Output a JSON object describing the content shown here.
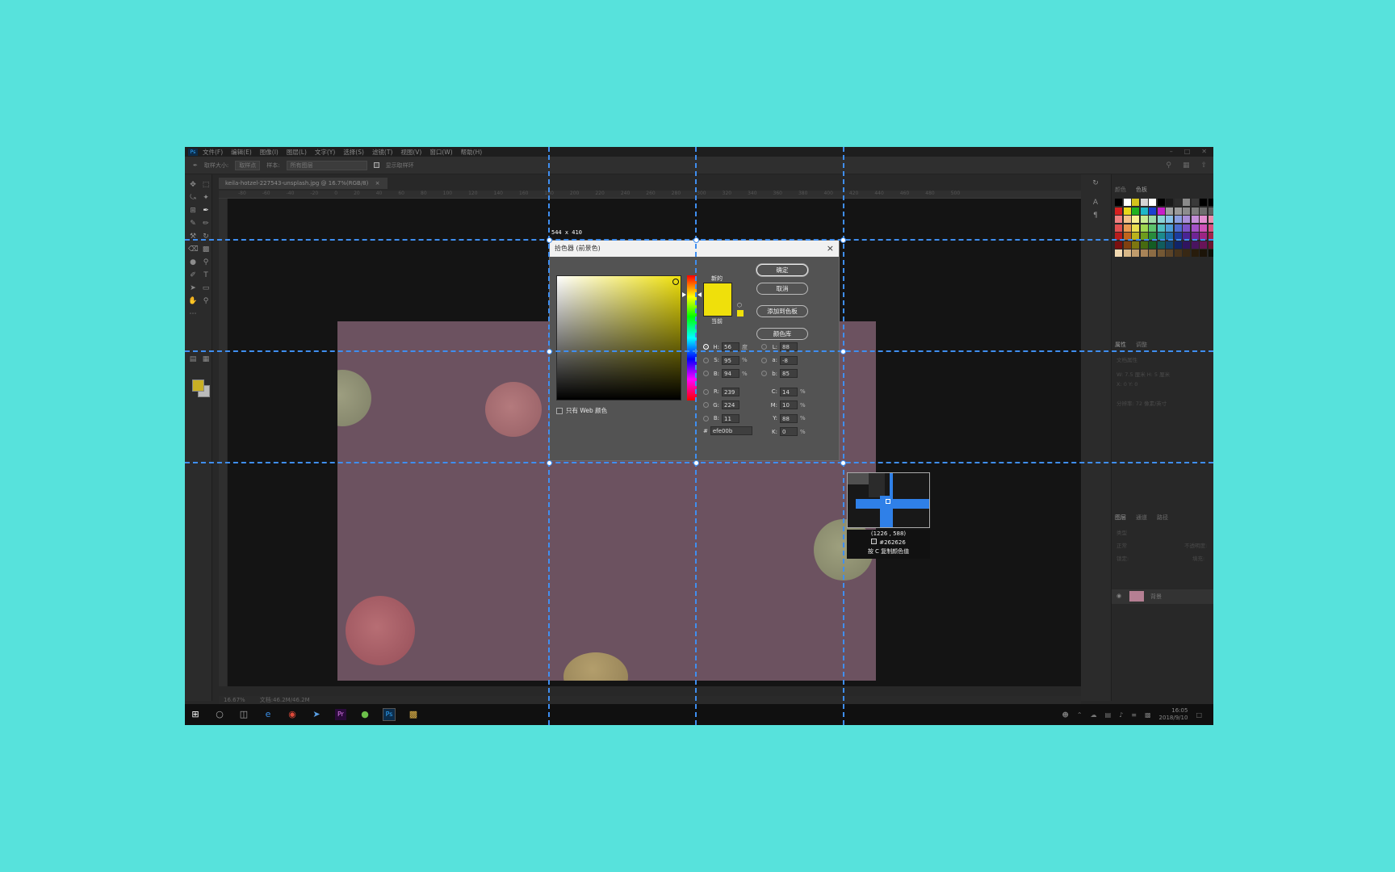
{
  "app": {
    "logo": "Ps",
    "menu": [
      "文件(F)",
      "编辑(E)",
      "图像(I)",
      "图层(L)",
      "文字(Y)",
      "选择(S)",
      "滤镜(T)",
      "视图(V)",
      "窗口(W)",
      "帮助(H)"
    ]
  },
  "options": {
    "sample_size_label": "取样大小:",
    "sample_size_value": "取样点",
    "sample_label": "样本:",
    "sample_value": "所有图层",
    "show_ring_label": "显示取样环"
  },
  "document": {
    "tab": "keila-hotzel-227543-unsplash.jpg @ 16.7%(RGB/8)",
    "tab_close": "×",
    "zoom": "16.67%",
    "doc_size": "文档:46.2M/46.2M"
  },
  "ruler_ticks": [
    "-80",
    "-60",
    "-40",
    "-20",
    "0",
    "20",
    "40",
    "60",
    "80",
    "100",
    "120",
    "140",
    "160",
    "180",
    "200",
    "220",
    "240",
    "260",
    "280",
    "300",
    "320",
    "340",
    "360",
    "380",
    "400",
    "420",
    "440",
    "460",
    "480",
    "500"
  ],
  "panels": {
    "swatches_tabs": [
      "颜色",
      "色板"
    ],
    "properties_tabs": [
      "属性",
      "调整"
    ],
    "properties_lines": [
      "文档属性",
      "W: 7.5 厘米      H: 5 厘米",
      "X: 0           Y: 0",
      "分辨率: 72 像素/英寸"
    ],
    "layers_tabs": [
      "图层",
      "通道",
      "路径"
    ],
    "layers_filter": "类型",
    "layers_blend": "正常",
    "layers_opacity": "不透明度:",
    "layers_lock": "锁定:",
    "layers_fill": "填充:",
    "layer_name": "背景"
  },
  "colors": {
    "accent": "#efe00b",
    "guide": "#3f8ef0",
    "swatch_rows": [
      [
        "#000000",
        "#ffffff",
        "#d2c21d",
        "#d4d4d4",
        "#ffffff",
        "#000000",
        "#1a1a1a",
        "#2d2d2d",
        "#8a8a8a",
        "#3a3a3a",
        "#000000",
        "#000000",
        "#d0d0d0",
        "#a9a9a9",
        "#b5b5b5",
        "#c7c7c7",
        "#283d7a"
      ],
      [
        "#d62020",
        "#e7d81b",
        "#20b120",
        "#1fb7c8",
        "#1b3fcf",
        "#c81fc8",
        "#a0a0a0",
        "#9a9a9a",
        "#8d8d8d",
        "#7d7d7d",
        "#6e6e6e",
        "#5e5e5e",
        "#4f4f4f",
        "#404040",
        "#303030",
        "#202020",
        "#151515"
      ],
      [
        "#f08080",
        "#f4c28a",
        "#f6ef90",
        "#c6ea92",
        "#9cd9a8",
        "#8cd4d6",
        "#88c2e8",
        "#8a9ee0",
        "#a98ed8",
        "#c48fd8",
        "#e48fd0",
        "#e88fae",
        "#e88f8f",
        "#b88e72",
        "#9e8a6a",
        "#8a8a6a",
        "#7a7a7a"
      ],
      [
        "#e05050",
        "#eb9a50",
        "#ebdf50",
        "#9ed650",
        "#5cc26c",
        "#4fbfc0",
        "#4e9fd8",
        "#4e6cd0",
        "#7c52c8",
        "#a452c8",
        "#d052b8",
        "#d85280",
        "#d05050",
        "#a06a48",
        "#806a44",
        "#6a6a44",
        "#585858"
      ],
      [
        "#b81c1c",
        "#c0641c",
        "#bab21c",
        "#6e9c1c",
        "#288c3c",
        "#1c8a8c",
        "#1c6aa8",
        "#1c3c9c",
        "#4a2494",
        "#702494",
        "#9c2484",
        "#a4244c",
        "#9c1c1c",
        "#703c20",
        "#583c20",
        "#3c3c20",
        "#303030"
      ],
      [
        "#7a1010",
        "#804010",
        "#7c7610",
        "#466a10",
        "#145c24",
        "#105c5c",
        "#104470",
        "#102468",
        "#301460",
        "#4a1460",
        "#681458",
        "#6c1430",
        "#681010",
        "#482410",
        "#382410",
        "#262410",
        "#1e1e1e"
      ],
      [
        "#f0d8b0",
        "#d8b888",
        "#c09c6c",
        "#a88458",
        "#8c6c44",
        "#745834",
        "#5c4428",
        "#48341c",
        "#382814",
        "#281c0c",
        "#1c1408",
        "#101008",
        "#ffffff",
        "#e0e0e0",
        "#c0c0c0",
        "#a0a0a0",
        "#808080"
      ]
    ]
  },
  "picker": {
    "size_readout": "544 x 410",
    "title": "拾色器 (前景色)",
    "close": "×",
    "new_label": "新的",
    "current_label": "当前",
    "buttons": [
      "确定",
      "取消",
      "添加到色板",
      "颜色库"
    ],
    "web_only": "只有 Web 颜色",
    "hue_pct": 0.155,
    "fields_left": [
      {
        "label": "H:",
        "value": "56",
        "unit": "度",
        "checked": true
      },
      {
        "label": "S:",
        "value": "95",
        "unit": "%"
      },
      {
        "label": "B:",
        "value": "94",
        "unit": "%"
      },
      {
        "label": "R:",
        "value": "239",
        "unit": ""
      },
      {
        "label": "G:",
        "value": "224",
        "unit": ""
      },
      {
        "label": "B:",
        "value": "11",
        "unit": ""
      }
    ],
    "fields_right": [
      {
        "label": "L:",
        "value": "88",
        "unit": ""
      },
      {
        "label": "a:",
        "value": "-8",
        "unit": ""
      },
      {
        "label": "b:",
        "value": "85",
        "unit": ""
      },
      {
        "label": "C:",
        "value": "14",
        "unit": "%"
      },
      {
        "label": "M:",
        "value": "10",
        "unit": "%"
      },
      {
        "label": "Y:",
        "value": "88",
        "unit": "%"
      },
      {
        "label": "K:",
        "value": "0",
        "unit": "%"
      }
    ],
    "hex_label": "#",
    "hex_value": "efe00b"
  },
  "loupe": {
    "coords": "(1226 , 588)",
    "hex": "#262626",
    "hint": "按 C 复制颜色值"
  },
  "taskbar": {
    "time": "16:05",
    "date": "2018/9/10"
  }
}
